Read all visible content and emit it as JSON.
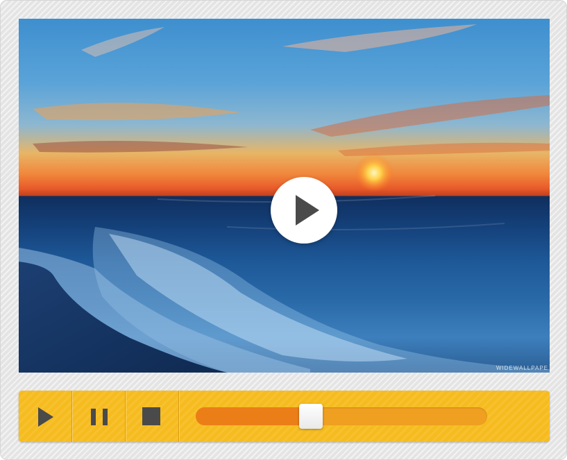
{
  "player": {
    "watermark": "WIDEWALLPAPE",
    "progress_fraction": 0.395
  },
  "controls": {
    "play_icon": "play-icon",
    "pause_icon": "pause-icon",
    "stop_icon": "stop-icon"
  },
  "colors": {
    "bar": "#f6bc1f",
    "progress_fill": "#ec7e18",
    "progress_track": "#f0a020",
    "icon": "#4a4a4a"
  }
}
